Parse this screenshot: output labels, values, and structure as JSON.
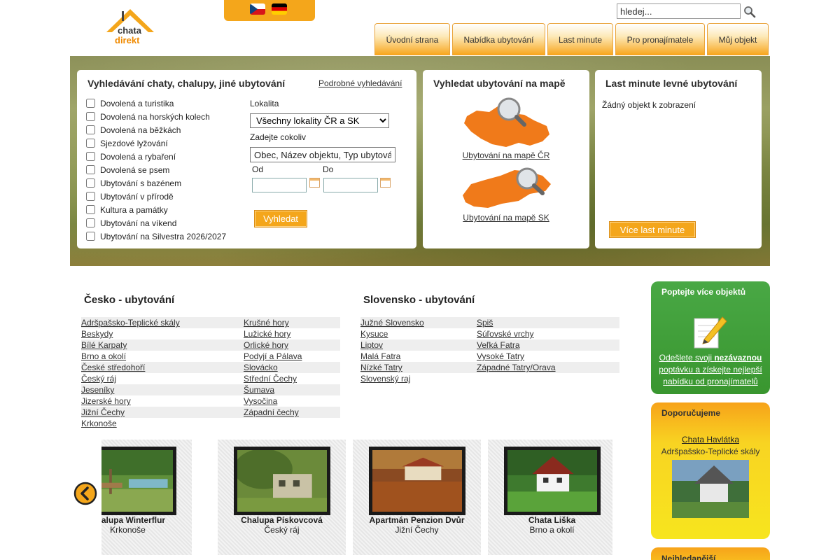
{
  "header": {
    "logo_line1": "chata",
    "logo_line2": "direkt",
    "languages": [
      "Čeština",
      "Deutsch"
    ],
    "search_value": "hledej...",
    "nav": [
      "Úvodní strana",
      "Nabídka ubytování",
      "Last minute",
      "Pro pronajímatele",
      "Můj objekt"
    ]
  },
  "search_panel": {
    "title": "Vyhledávání chaty, chalupy, jiné ubytování",
    "advanced_link": "Podrobné vyhledávání",
    "categories": [
      "Dovolená a turistika",
      "Dovolená na horských kolech",
      "Dovolená na běžkách",
      "Sjezdové lyžování",
      "Dovolená a rybaření",
      "Dovolená se psem",
      "Ubytování s bazénem",
      "Ubytování v přírodě",
      "Kultura a památky",
      "Ubytování na víkend",
      "Ubytování na Silvestra 2026/2027"
    ],
    "locality_label": "Lokalita",
    "locality_value": "Všechny lokality ČR a SK",
    "anything_label": "Zadejte cokoliv",
    "anything_value": "Obec, Název objektu, Typ ubytování",
    "from_label": "Od",
    "to_label": "Do",
    "submit_label": "Vyhledat"
  },
  "map_panel": {
    "title": "Vyhledat ubytování na mapě",
    "cz_link": "Ubytování na mapě ČR",
    "sk_link": "Ubytování na mapě SK"
  },
  "lastminute_panel": {
    "title": "Last minute levné ubytování",
    "empty_text": "Žádný objekt k zobrazení",
    "more_label": "Více last minute"
  },
  "cz": {
    "title": "Česko - ubytování",
    "col1": [
      "Adršpašsko-Teplické skály",
      "Beskydy",
      "Bílé Karpaty",
      "Brno a okolí",
      "České středohoří",
      "Český ráj",
      "Jeseníky",
      "Jizerské hory",
      "Jižní Čechy",
      "Krkonoše"
    ],
    "col2": [
      "Krušné hory",
      "Lužické hory",
      "Orlické hory",
      "Podyjí a Pálava",
      "Slovácko",
      "Střední Čechy",
      "Šumava",
      "Vysočina",
      "Západní čechy"
    ]
  },
  "sk": {
    "title": "Slovensko - ubytování",
    "col1": [
      "Južné Slovensko",
      "Kysuce",
      "Liptov",
      "Malá Fatra",
      "Nízké Tatry",
      "Slovenský raj"
    ],
    "col2": [
      "Spiš",
      "Súľovské vrchy",
      "Veľká Fatra",
      "Vysoké Tatry",
      "Západné Tatry/Orava"
    ]
  },
  "gallery": [
    {
      "name": "Chalupa Winterflur",
      "place": "Krkonoše"
    },
    {
      "name": "Chalupa Pískovcová",
      "place": "Český ráj"
    },
    {
      "name": "Apartmán Penzion Dvůr",
      "place": "Jižní Čechy"
    },
    {
      "name": "Chata Liška",
      "place": "Brno a okolí"
    }
  ],
  "sidebar": {
    "inquiry_title": "Poptejte více objektů",
    "inquiry_pre": "Odešlete svoji ",
    "inquiry_bold": "nezávaznou",
    "inquiry_post": " poptávku a získejte nejlepší nabídku od pronajímatelů",
    "recommend_title": "Doporučujeme",
    "recommend_name": "Chata Havlátka",
    "recommend_place": "Adršpašsko-Teplické skály",
    "popular_title": "Nejhledanější"
  },
  "colors": {
    "accent_orange": "#f4a61b",
    "green_box": "#3f9e36",
    "yellow_box": "#f8d422"
  }
}
